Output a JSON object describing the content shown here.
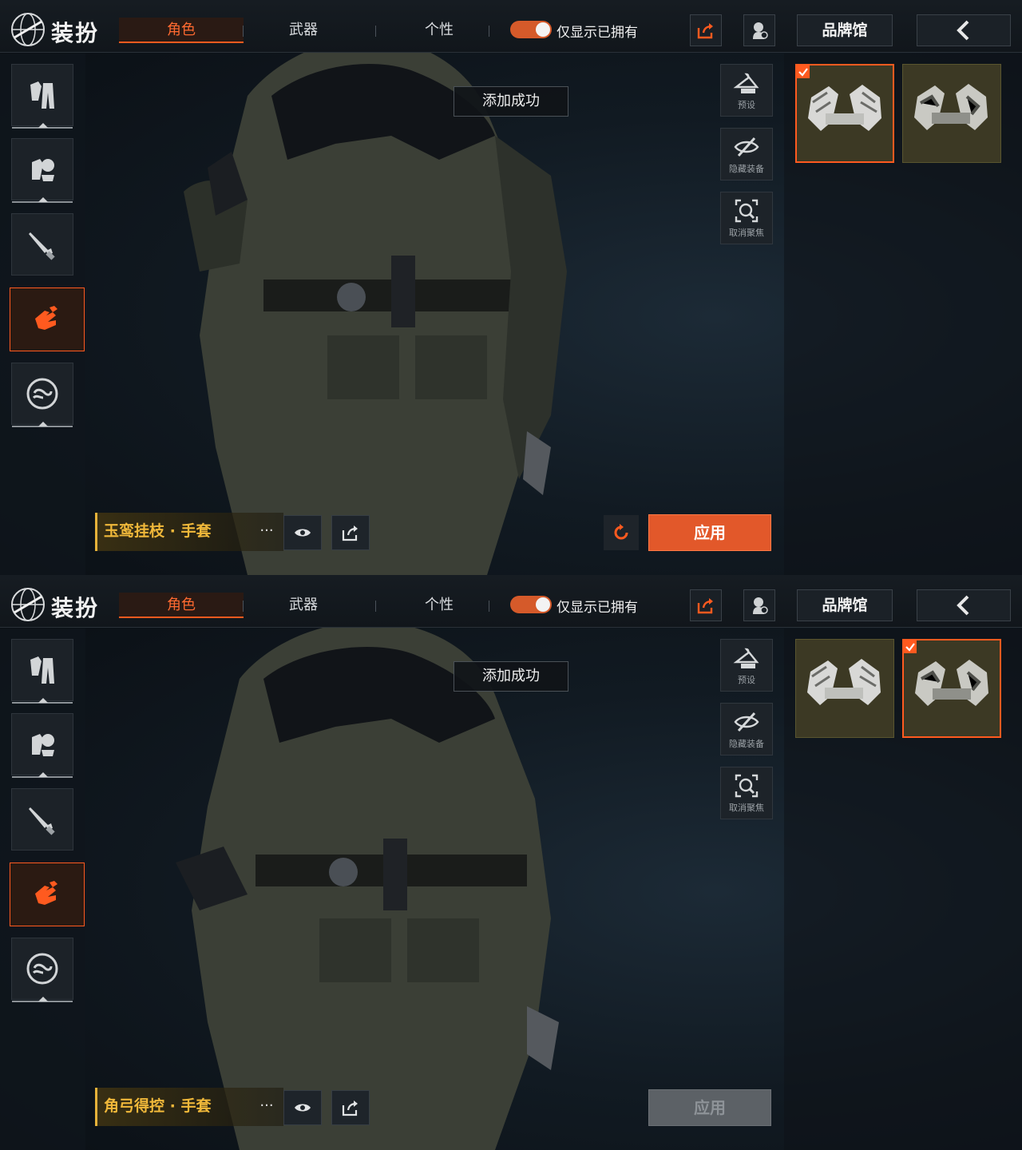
{
  "panels": [
    {
      "header": {
        "title": "装扮",
        "tabs": [
          "角色",
          "武器",
          "个性"
        ],
        "active_tab": 0,
        "owned_toggle_label": "仅显示已拥有",
        "owned_toggle_on": true,
        "brand_label": "品牌馆"
      },
      "sidebar": {
        "categories": [
          "outfit-icon",
          "outfit-set-icon",
          "knife-icon",
          "gloves-icon",
          "emote-icon"
        ],
        "active_index": 3
      },
      "toast": "添加成功",
      "tools": [
        {
          "label": "预设",
          "icon": "hanger-icon"
        },
        {
          "label": "隐藏装备",
          "icon": "eye-off-icon"
        },
        {
          "label": "取消聚焦",
          "icon": "focus-icon"
        }
      ],
      "items": {
        "selected_index": 0,
        "count": 2
      },
      "bottom": {
        "item_name": "玉鸾挂枝 · 手套",
        "more_label": "···",
        "apply_label": "应用",
        "apply_enabled": true,
        "show_reset": true
      }
    },
    {
      "header": {
        "title": "装扮",
        "tabs": [
          "角色",
          "武器",
          "个性"
        ],
        "active_tab": 0,
        "owned_toggle_label": "仅显示已拥有",
        "owned_toggle_on": true,
        "brand_label": "品牌馆"
      },
      "sidebar": {
        "categories": [
          "outfit-icon",
          "outfit-set-icon",
          "knife-icon",
          "gloves-icon",
          "emote-icon"
        ],
        "active_index": 3
      },
      "toast": "添加成功",
      "tools": [
        {
          "label": "预设",
          "icon": "hanger-icon"
        },
        {
          "label": "隐藏装备",
          "icon": "eye-off-icon"
        },
        {
          "label": "取消聚焦",
          "icon": "focus-icon"
        }
      ],
      "items": {
        "selected_index": 1,
        "count": 2
      },
      "bottom": {
        "item_name": "角弓得控 · 手套",
        "more_label": "···",
        "apply_label": "应用",
        "apply_enabled": false,
        "show_reset": false
      }
    }
  ],
  "colors": {
    "accent": "#ff5a1f",
    "item_name": "#f0b83a",
    "apply_enabled": "#e2582a",
    "apply_disabled": "#5c6166",
    "item_bg": "#3c3924"
  }
}
